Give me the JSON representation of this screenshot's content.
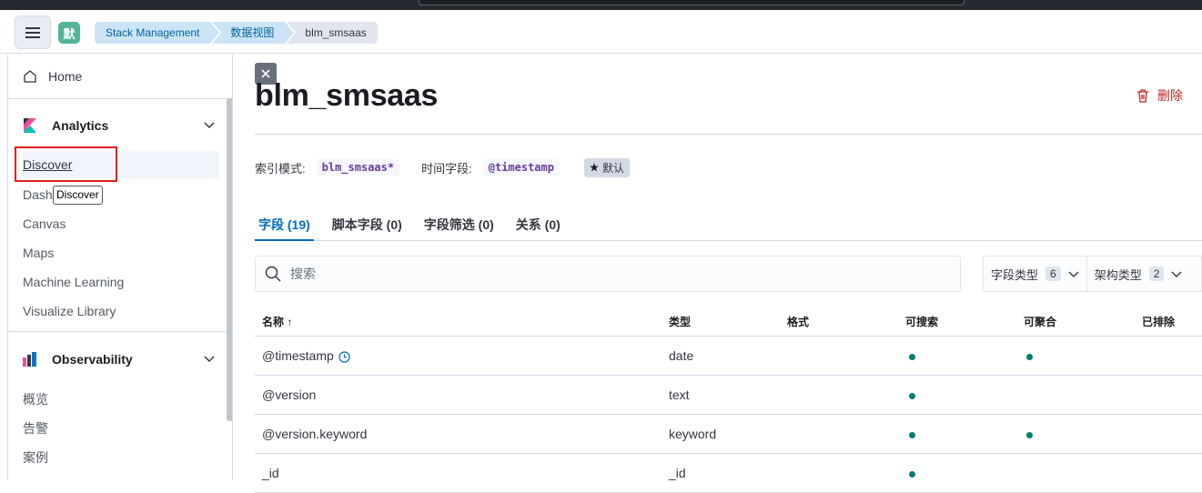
{
  "header": {
    "space_initial": "默",
    "breadcrumbs": [
      "Stack Management",
      "数据视图",
      "blm_smsaas"
    ]
  },
  "sidebar": {
    "home": "Home",
    "analytics": {
      "title": "Analytics",
      "items": [
        "Discover",
        "Dash",
        "Canvas",
        "Maps",
        "Machine Learning",
        "Visualize Library"
      ]
    },
    "observability": {
      "title": "Observability",
      "items": [
        "概览",
        "告警",
        "案例"
      ]
    },
    "tooltip": "Discover"
  },
  "main": {
    "title": "blm_smsaas",
    "delete_label": "删除",
    "index_pattern_label": "索引模式:",
    "index_pattern_value": "blm_smsaas*",
    "time_field_label": "时间字段:",
    "time_field_value": "@timestamp",
    "default_badge": "默认",
    "tabs": [
      "字段 (19)",
      "脚本字段 (0)",
      "字段筛选 (0)",
      "关系 (0)"
    ],
    "search_placeholder": "搜索",
    "filters": [
      {
        "label": "字段类型",
        "count": "6"
      },
      {
        "label": "架构类型",
        "count": "2"
      }
    ],
    "columns": [
      "名称",
      "类型",
      "格式",
      "可搜索",
      "可聚合",
      "已排除"
    ],
    "rows": [
      {
        "name": "@timestamp",
        "type": "date",
        "searchable": true,
        "aggregatable": true,
        "time": true
      },
      {
        "name": "@version",
        "type": "text",
        "searchable": true,
        "aggregatable": false,
        "time": false
      },
      {
        "name": "@version.keyword",
        "type": "keyword",
        "searchable": true,
        "aggregatable": true,
        "time": false
      },
      {
        "name": "_id",
        "type": "_id",
        "searchable": true,
        "aggregatable": false,
        "time": false
      }
    ]
  },
  "colors": {
    "accent": "#006bb8",
    "danger": "#bd271e",
    "dot": "#017d73",
    "highlight": "#e02020"
  }
}
